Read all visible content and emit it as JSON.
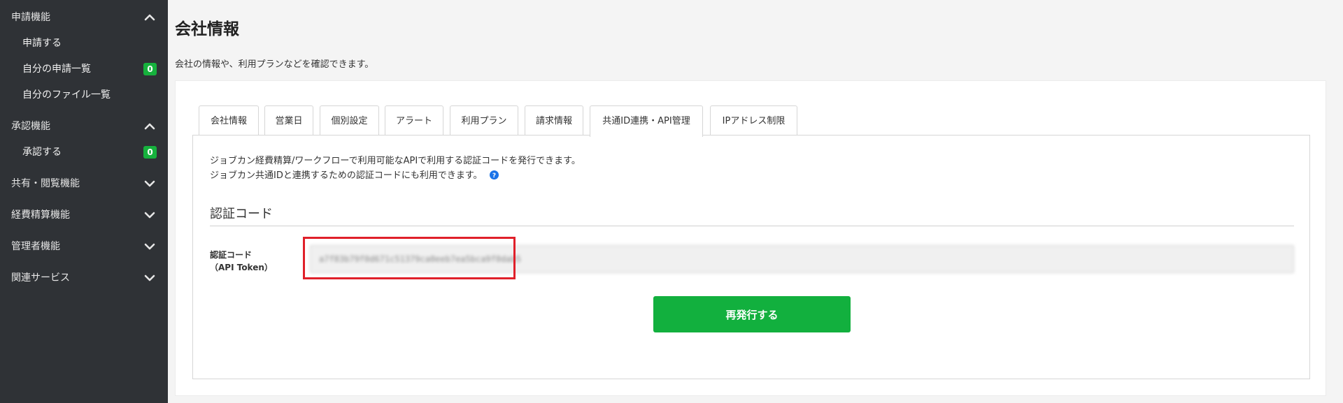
{
  "sidebar": {
    "groups": [
      {
        "label": "申請機能",
        "expanded": true,
        "items": [
          {
            "label": "申請する"
          },
          {
            "label": "自分の申請一覧",
            "badge": "0"
          },
          {
            "label": "自分のファイル一覧"
          }
        ]
      },
      {
        "label": "承認機能",
        "expanded": true,
        "items": [
          {
            "label": "承認する",
            "badge": "0"
          }
        ]
      },
      {
        "label": "共有・閲覧機能",
        "expanded": false
      },
      {
        "label": "経費精算機能",
        "expanded": false
      },
      {
        "label": "管理者機能",
        "expanded": false
      },
      {
        "label": "関連サービス",
        "expanded": false
      }
    ]
  },
  "page": {
    "title": "会社情報",
    "description": "会社の情報や、利用プランなどを確認できます。"
  },
  "tabs": [
    {
      "label": "会社情報",
      "active": false
    },
    {
      "label": "営業日",
      "active": false
    },
    {
      "label": "個別設定",
      "active": false
    },
    {
      "label": "アラート",
      "active": false
    },
    {
      "label": "利用プラン",
      "active": false
    },
    {
      "label": "請求情報",
      "active": false
    },
    {
      "label": "共通ID連携・API管理",
      "active": true
    },
    {
      "label": "IPアドレス制限",
      "active": false
    }
  ],
  "panel": {
    "info_line1": "ジョブカン経費精算/ワークフローで利用可能なAPIで利用する認証コードを発行できます。",
    "info_line2": "ジョブカン共通IDと連携するための認証コードにも利用できます。",
    "section_title": "認証コード",
    "field_label_line1": "認証コード",
    "field_label_line2": "（API Token）",
    "token_value": "a7f83b79f0d671c51379ca0eeb7ea5bca9f0dab5",
    "reissue_button": "再発行する"
  },
  "colors": {
    "sidebar_bg": "#2f3236",
    "badge_green": "#16b13d",
    "primary_button": "#12b03e",
    "highlight_red": "#e0202a",
    "help_icon_blue": "#1a73e8"
  },
  "icons": {
    "expanded": "chevron-up-icon",
    "collapsed": "chevron-down-icon",
    "help": "help-circle-icon"
  }
}
